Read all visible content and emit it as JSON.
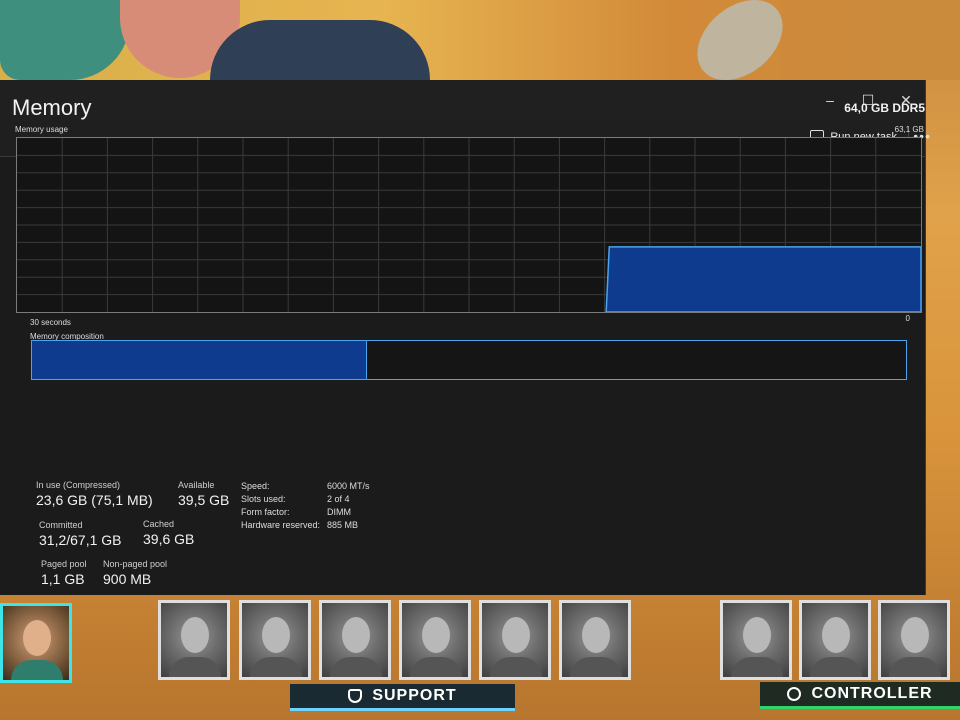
{
  "window": {
    "controls": {
      "minimize": "–",
      "maximize": "☐",
      "close": "✕"
    },
    "toolbar": {
      "run_new_task": "Run new task",
      "more": "•••"
    }
  },
  "memory": {
    "title": "Memory",
    "total": "64,0 GB DDR5",
    "usage_label": "Memory usage",
    "usage_max": "63,1 GB",
    "graph": {
      "time_label": "30 seconds",
      "zero_label": "0",
      "usage_history_gb": [
        0,
        0,
        0,
        0,
        0,
        0,
        0,
        0,
        0,
        0,
        0,
        0,
        0,
        0,
        0,
        0,
        0,
        0,
        0,
        23.6,
        23.6,
        23.6,
        23.6,
        23.6,
        23.6,
        23.6,
        23.6,
        23.6,
        23.6,
        23.6
      ],
      "max_gb": 63.1
    },
    "composition": {
      "label": "Memory composition",
      "in_use_fraction": 0.383
    },
    "stats": {
      "in_use_label": "In use (Compressed)",
      "in_use_value": "23,6 GB (75,1 MB)",
      "available_label": "Available",
      "available_value": "39,5 GB",
      "committed_label": "Committed",
      "committed_value": "31,2/67,1 GB",
      "cached_label": "Cached",
      "cached_value": "39,6 GB",
      "paged_label": "Paged pool",
      "paged_value": "1,1 GB",
      "nonpaged_label": "Non-paged pool",
      "nonpaged_value": "900 MB"
    },
    "specs": {
      "speed_label": "Speed:",
      "speed_value": "6000 MT/s",
      "slots_label": "Slots used:",
      "slots_value": "2 of 4",
      "form_label": "Form factor:",
      "form_value": "DIMM",
      "reserved_label": "Hardware reserved:",
      "reserved_value": "885 MB"
    }
  },
  "game": {
    "support_label": "SUPPORT",
    "controller_label": "CONTROLLER"
  },
  "colors": {
    "accent": "#4ca3f0",
    "fill": "#0e3b8e",
    "window_bg": "#1b1b1b"
  }
}
